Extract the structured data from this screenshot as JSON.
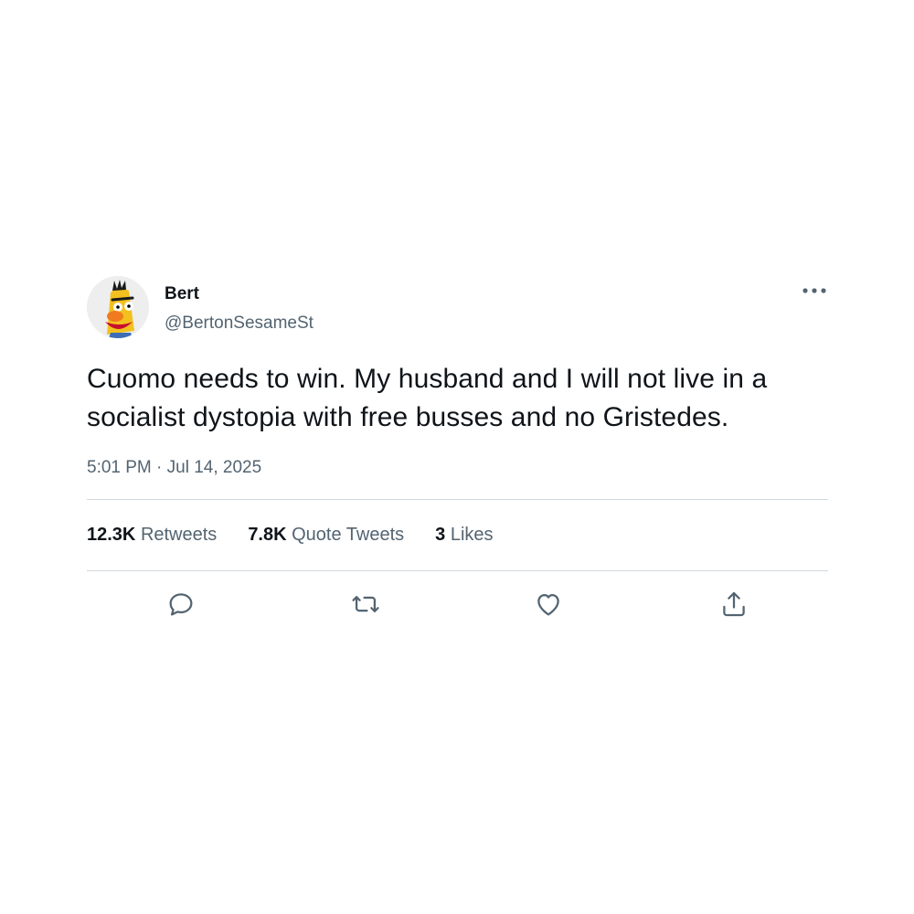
{
  "author": {
    "display_name": "Bert",
    "handle": "@BertonSesameSt",
    "avatar_icon": "bert-avatar"
  },
  "tweet": {
    "text": "Cuomo needs to win. My husband and I will not live in a socialist dystopia with free busses and no Gristedes.",
    "timestamp": "5:01 PM · Jul 14, 2025"
  },
  "stats": {
    "retweets_count": "12.3K",
    "retweets_label": "Retweets",
    "quote_tweets_count": "7.8K",
    "quote_tweets_label": "Quote Tweets",
    "likes_count": "3",
    "likes_label": "Likes"
  },
  "actions": {
    "reply_icon": "reply-icon",
    "retweet_icon": "retweet-icon",
    "like_icon": "heart-icon",
    "share_icon": "share-icon"
  },
  "colors": {
    "text_primary": "#0f1419",
    "text_secondary": "#536471",
    "divider": "#cfd9de"
  }
}
